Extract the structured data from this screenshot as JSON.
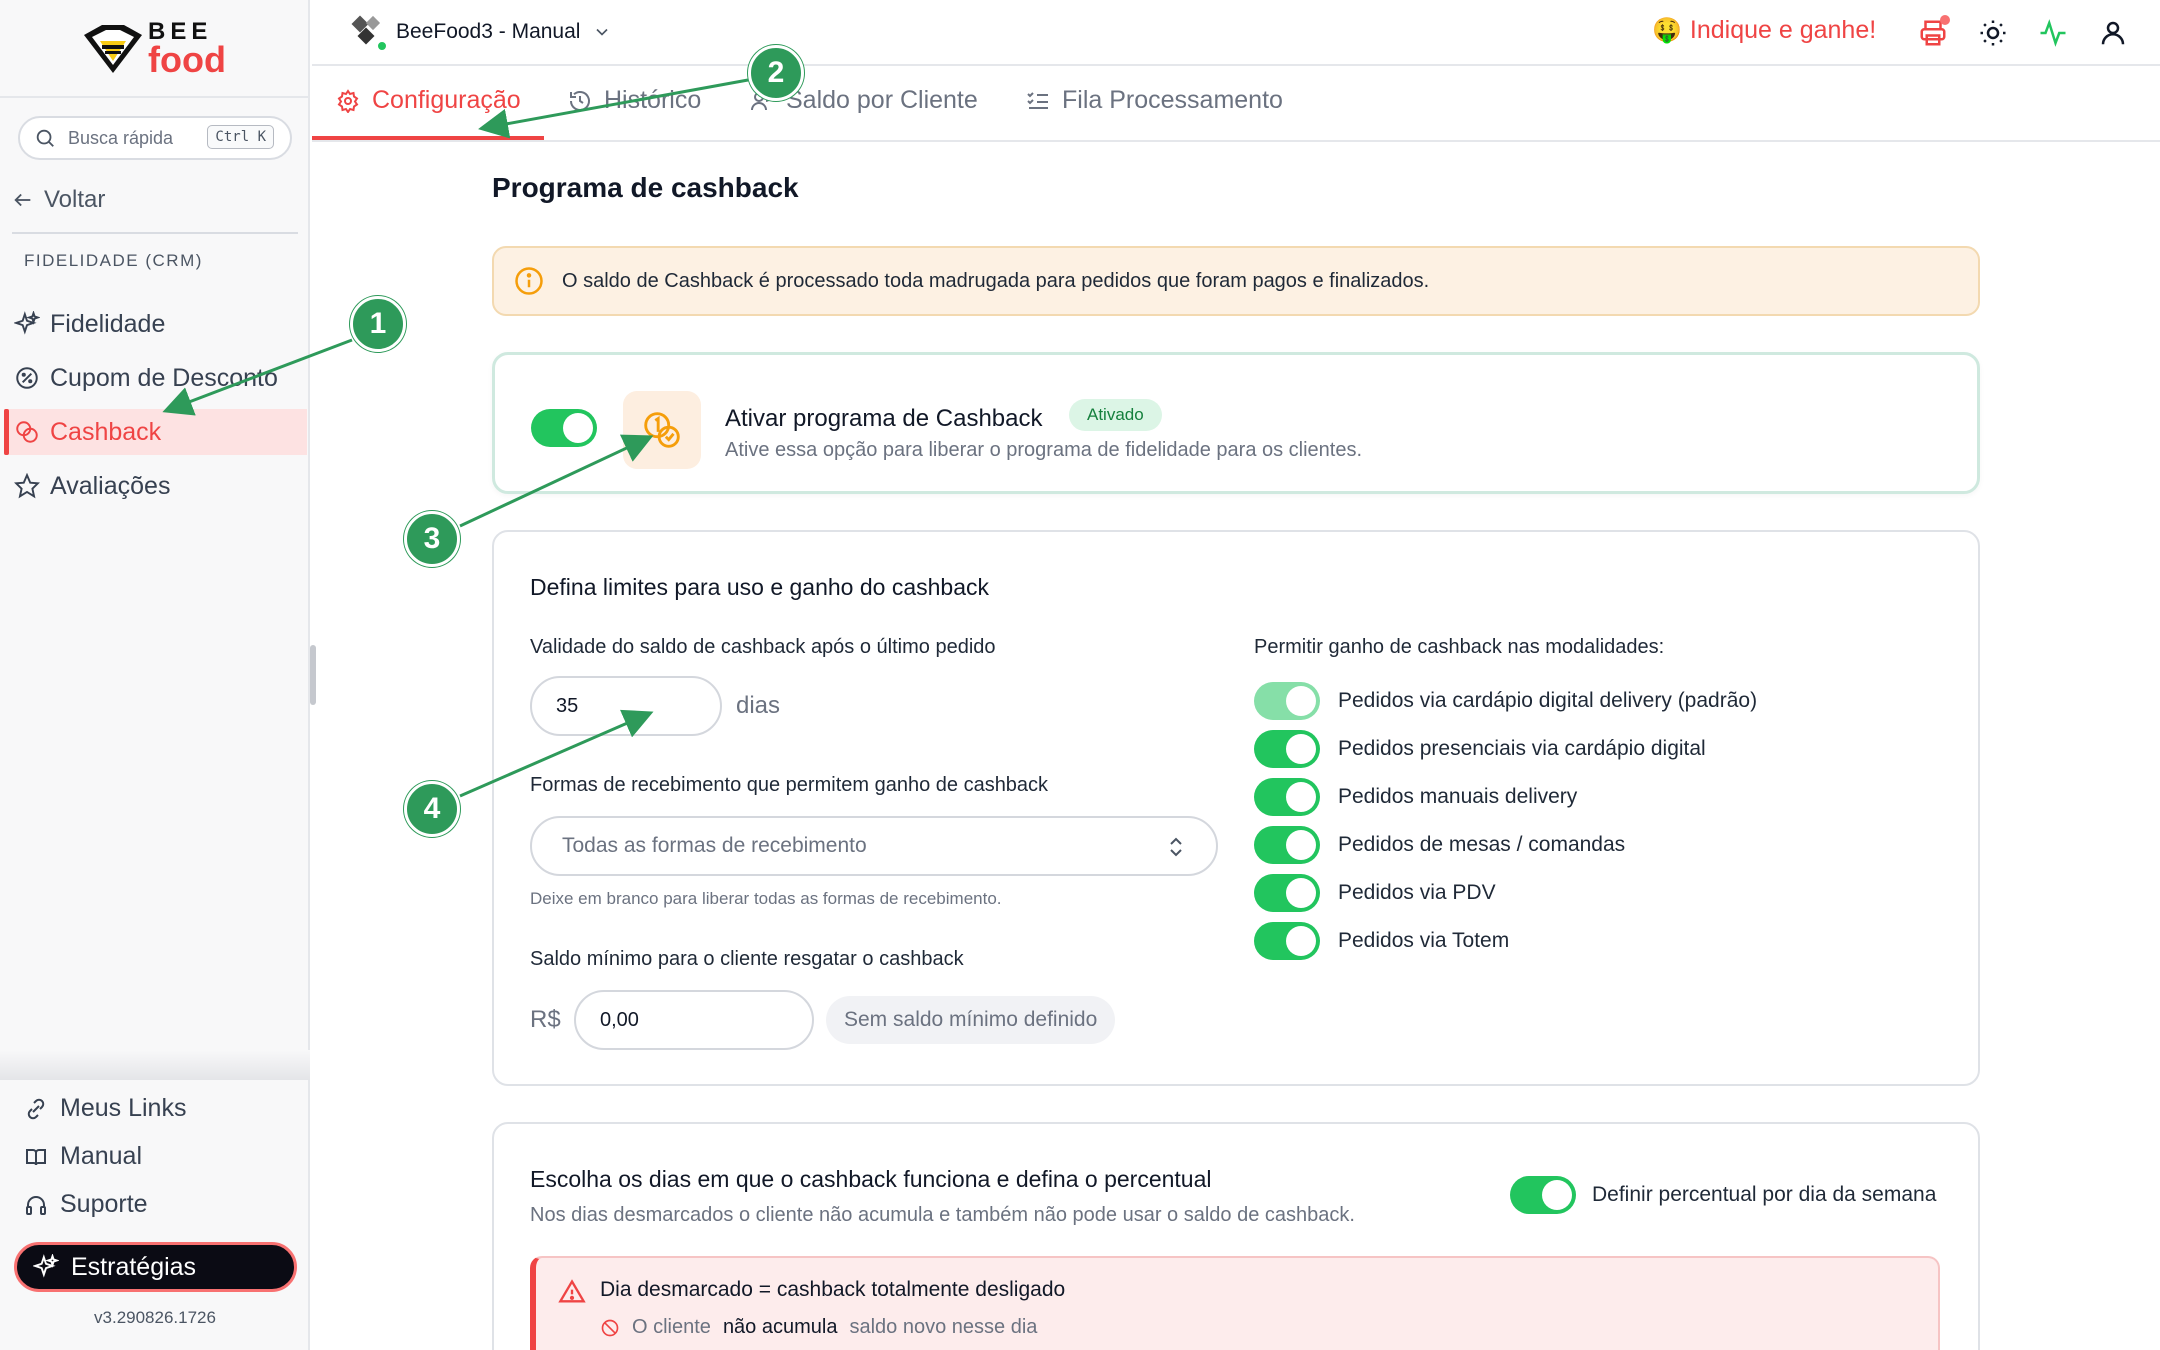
{
  "sidebar": {
    "logo": {
      "top": "BEE",
      "bottom": "food"
    },
    "search": {
      "placeholder": "Busca rápida",
      "shortcut": "Ctrl K"
    },
    "back_label": "Voltar",
    "section_label": "FIDELIDADE (CRM)",
    "items": [
      {
        "label": "Fidelidade",
        "icon": "sparkles-icon"
      },
      {
        "label": "Cupom de Desconto",
        "icon": "discount-icon"
      },
      {
        "label": "Cashback",
        "icon": "coins-icon",
        "active": true
      },
      {
        "label": "Avaliações",
        "icon": "star-icon"
      }
    ],
    "footer": [
      {
        "label": "Meus Links",
        "icon": "link-icon"
      },
      {
        "label": "Manual",
        "icon": "book-icon"
      },
      {
        "label": "Suporte",
        "icon": "headphones-icon"
      }
    ],
    "strategies_label": "Estratégias",
    "version": "v3.290826.1726"
  },
  "header": {
    "store_name": "BeeFood3 - Manual",
    "referral": {
      "emoji": "🤑",
      "label": "Indique e ganhe!"
    },
    "icons": [
      "printer-icon",
      "sun-icon",
      "activity-icon",
      "user-icon"
    ]
  },
  "tabs": [
    {
      "label": "Configuração",
      "icon": "gear-icon",
      "active": true
    },
    {
      "label": "Histórico",
      "icon": "history-icon"
    },
    {
      "label": "Saldo por Cliente",
      "icon": "users-icon"
    },
    {
      "label": "Fila Processamento",
      "icon": "list-check-icon"
    }
  ],
  "main": {
    "title": "Programa de cashback",
    "info_banner": "O saldo de Cashback é processado toda madrugada para pedidos que foram pagos e finalizados.",
    "activate": {
      "title": "Ativar programa de Cashback",
      "badge": "Ativado",
      "description": "Ative essa opção para liberar o programa de fidelidade para os clientes.",
      "enabled": true
    },
    "limits": {
      "title": "Defina limites para uso e ganho do cashback",
      "validity_label": "Validade do saldo de cashback após o último pedido",
      "validity_value": "35",
      "validity_unit": "dias",
      "payment_label": "Formas de recebimento que permitem ganho de cashback",
      "payment_placeholder": "Todas as formas de recebimento",
      "payment_hint": "Deixe em branco para liberar todas as formas de recebimento.",
      "min_label": "Saldo mínimo para o cliente resgatar o cashback",
      "min_currency": "R$",
      "min_value": "0,00",
      "min_tag": "Sem saldo mínimo definido",
      "modalities_label": "Permitir ganho de cashback nas modalidades:",
      "modalities": [
        {
          "label": "Pedidos via cardápio digital delivery (padrão)",
          "enabled": true,
          "locked": true
        },
        {
          "label": "Pedidos presenciais via cardápio digital",
          "enabled": true
        },
        {
          "label": "Pedidos manuais delivery",
          "enabled": true
        },
        {
          "label": "Pedidos de mesas / comandas",
          "enabled": true
        },
        {
          "label": "Pedidos via PDV",
          "enabled": true
        },
        {
          "label": "Pedidos via Totem",
          "enabled": true
        }
      ]
    },
    "days": {
      "title": "Escolha os dias em que o cashback funciona e defina o percentual",
      "subtitle": "Nos dias desmarcados o cliente não acumula e também não pode usar o saldo de cashback.",
      "per_day_label": "Definir percentual por dia da semana",
      "alert_title": "Dia desmarcado = cashback totalmente desligado",
      "alert_line_pre": "O cliente",
      "alert_line_bold": "não acumula",
      "alert_line_post": "saldo novo nesse dia"
    }
  },
  "annotations": [
    "1",
    "2",
    "3",
    "4"
  ],
  "colors": {
    "accent": "#ef4444",
    "success": "#22c55e",
    "marker": "#2e9a5a"
  }
}
